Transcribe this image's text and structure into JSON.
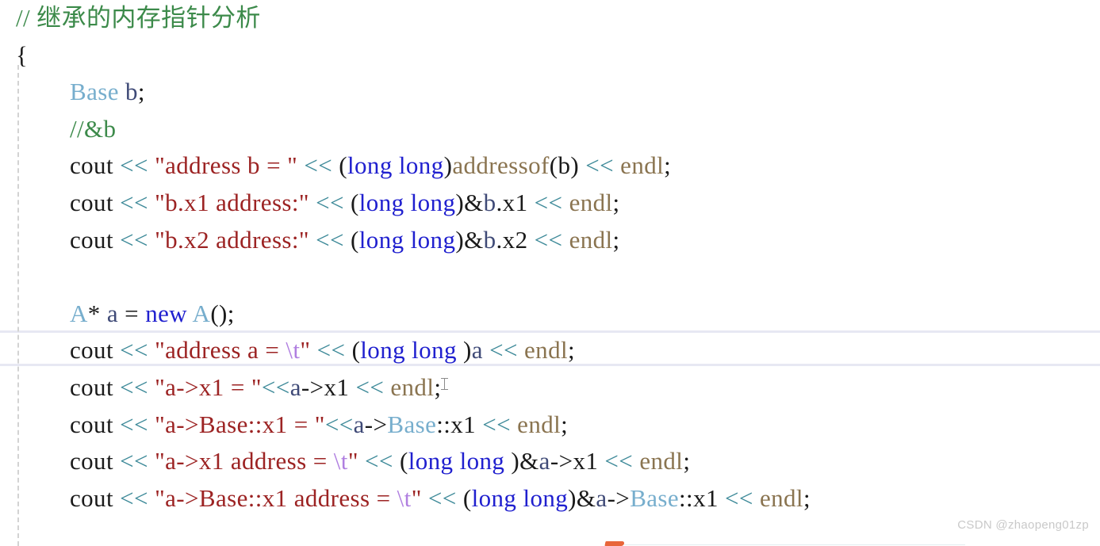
{
  "editor": {
    "language": "cpp",
    "background_color": "#ffffff",
    "current_line_number": 9,
    "indent_guide_color": "#d3d3d3",
    "current_line_highlight_color": "#e7e8f3"
  },
  "palette": {
    "comment": "#3c8a4a",
    "string": "#9c2323",
    "escape": "#b07fe0",
    "keyword": "#2020cf",
    "type": "#77aecd",
    "variable": "#3f4a77",
    "operator": "#3e8a99",
    "function": "#8a7450",
    "plain": "#1a1a1a"
  },
  "lines": [
    {
      "id": 1,
      "indent": 0,
      "tokens": [
        {
          "t": "comment",
          "v": "// 继承的内存指针分析"
        }
      ]
    },
    {
      "id": 2,
      "indent": 0,
      "tokens": [
        {
          "t": "punct",
          "v": "{"
        }
      ]
    },
    {
      "id": 3,
      "indent": 1,
      "tokens": [
        {
          "t": "type",
          "v": "Base"
        },
        {
          "t": "plain",
          "v": " "
        },
        {
          "t": "var",
          "v": "b"
        },
        {
          "t": "punct",
          "v": ";"
        }
      ]
    },
    {
      "id": 4,
      "indent": 1,
      "tokens": [
        {
          "t": "comment",
          "v": "//&b"
        }
      ]
    },
    {
      "id": 5,
      "indent": 1,
      "tokens": [
        {
          "t": "plain",
          "v": "cout "
        },
        {
          "t": "operator",
          "v": "<<"
        },
        {
          "t": "plain",
          "v": " "
        },
        {
          "t": "string",
          "v": "\"address b = \""
        },
        {
          "t": "plain",
          "v": " "
        },
        {
          "t": "operator",
          "v": "<<"
        },
        {
          "t": "plain",
          "v": " ("
        },
        {
          "t": "keyword",
          "v": "long long"
        },
        {
          "t": "plain",
          "v": ")"
        },
        {
          "t": "func",
          "v": "addressof"
        },
        {
          "t": "plain",
          "v": "(b) "
        },
        {
          "t": "operator",
          "v": "<<"
        },
        {
          "t": "plain",
          "v": " "
        },
        {
          "t": "stream",
          "v": "endl"
        },
        {
          "t": "punct",
          "v": ";"
        }
      ]
    },
    {
      "id": 6,
      "indent": 1,
      "tokens": [
        {
          "t": "plain",
          "v": "cout "
        },
        {
          "t": "operator",
          "v": "<<"
        },
        {
          "t": "plain",
          "v": " "
        },
        {
          "t": "string",
          "v": "\"b.x1 address:\""
        },
        {
          "t": "plain",
          "v": " "
        },
        {
          "t": "operator",
          "v": "<<"
        },
        {
          "t": "plain",
          "v": " ("
        },
        {
          "t": "keyword",
          "v": "long long"
        },
        {
          "t": "plain",
          "v": ")&"
        },
        {
          "t": "var",
          "v": "b"
        },
        {
          "t": "plain",
          "v": ".x1 "
        },
        {
          "t": "operator",
          "v": "<<"
        },
        {
          "t": "plain",
          "v": " "
        },
        {
          "t": "stream",
          "v": "endl"
        },
        {
          "t": "punct",
          "v": ";"
        }
      ]
    },
    {
      "id": 7,
      "indent": 1,
      "tokens": [
        {
          "t": "plain",
          "v": "cout "
        },
        {
          "t": "operator",
          "v": "<<"
        },
        {
          "t": "plain",
          "v": " "
        },
        {
          "t": "string",
          "v": "\"b.x2 address:\""
        },
        {
          "t": "plain",
          "v": " "
        },
        {
          "t": "operator",
          "v": "<<"
        },
        {
          "t": "plain",
          "v": " ("
        },
        {
          "t": "keyword",
          "v": "long long"
        },
        {
          "t": "plain",
          "v": ")&"
        },
        {
          "t": "var",
          "v": "b"
        },
        {
          "t": "plain",
          "v": ".x2 "
        },
        {
          "t": "operator",
          "v": "<<"
        },
        {
          "t": "plain",
          "v": " "
        },
        {
          "t": "stream",
          "v": "endl"
        },
        {
          "t": "punct",
          "v": ";"
        }
      ]
    },
    {
      "id": 8,
      "indent": 1,
      "tokens": []
    },
    {
      "id": 9,
      "indent": 1,
      "tokens": [
        {
          "t": "type",
          "v": "A"
        },
        {
          "t": "plain",
          "v": "* "
        },
        {
          "t": "var",
          "v": "a"
        },
        {
          "t": "plain",
          "v": " = "
        },
        {
          "t": "keyword",
          "v": "new"
        },
        {
          "t": "plain",
          "v": " "
        },
        {
          "t": "type",
          "v": "A"
        },
        {
          "t": "plain",
          "v": "()"
        },
        {
          "t": "punct",
          "v": ";"
        }
      ]
    },
    {
      "id": 10,
      "indent": 1,
      "highlighted": true,
      "tokens": [
        {
          "t": "plain",
          "v": "cout "
        },
        {
          "t": "operator",
          "v": "<<"
        },
        {
          "t": "plain",
          "v": " "
        },
        {
          "t": "string",
          "v": "\"address a = "
        },
        {
          "t": "escape",
          "v": "\\t"
        },
        {
          "t": "string",
          "v": "\""
        },
        {
          "t": "plain",
          "v": " "
        },
        {
          "t": "operator",
          "v": "<<"
        },
        {
          "t": "plain",
          "v": " ("
        },
        {
          "t": "keyword",
          "v": "long long"
        },
        {
          "t": "plain",
          "v": " )"
        },
        {
          "t": "var",
          "v": "a"
        },
        {
          "t": "plain",
          "v": " "
        },
        {
          "t": "operator",
          "v": "<<"
        },
        {
          "t": "plain",
          "v": " "
        },
        {
          "t": "stream",
          "v": "endl"
        },
        {
          "t": "punct",
          "v": ";"
        }
      ]
    },
    {
      "id": 11,
      "indent": 1,
      "caret_at_end": true,
      "tokens": [
        {
          "t": "plain",
          "v": "cout "
        },
        {
          "t": "operator",
          "v": "<<"
        },
        {
          "t": "plain",
          "v": " "
        },
        {
          "t": "string",
          "v": "\"a->x1 = \""
        },
        {
          "t": "operator",
          "v": "<<"
        },
        {
          "t": "var",
          "v": "a"
        },
        {
          "t": "plain",
          "v": "->x1 "
        },
        {
          "t": "operator",
          "v": "<<"
        },
        {
          "t": "plain",
          "v": " "
        },
        {
          "t": "stream",
          "v": "endl"
        },
        {
          "t": "punct",
          "v": ";"
        }
      ]
    },
    {
      "id": 12,
      "indent": 1,
      "tokens": [
        {
          "t": "plain",
          "v": "cout "
        },
        {
          "t": "operator",
          "v": "<<"
        },
        {
          "t": "plain",
          "v": " "
        },
        {
          "t": "string",
          "v": "\"a->Base::x1 = \""
        },
        {
          "t": "operator",
          "v": "<<"
        },
        {
          "t": "var",
          "v": "a"
        },
        {
          "t": "plain",
          "v": "->"
        },
        {
          "t": "type",
          "v": "Base"
        },
        {
          "t": "plain",
          "v": "::x1 "
        },
        {
          "t": "operator",
          "v": "<<"
        },
        {
          "t": "plain",
          "v": " "
        },
        {
          "t": "stream",
          "v": "endl"
        },
        {
          "t": "punct",
          "v": ";"
        }
      ]
    },
    {
      "id": 13,
      "indent": 1,
      "tokens": [
        {
          "t": "plain",
          "v": "cout "
        },
        {
          "t": "operator",
          "v": "<<"
        },
        {
          "t": "plain",
          "v": " "
        },
        {
          "t": "string",
          "v": "\"a->x1 address = "
        },
        {
          "t": "escape",
          "v": "\\t"
        },
        {
          "t": "string",
          "v": "\""
        },
        {
          "t": "plain",
          "v": " "
        },
        {
          "t": "operator",
          "v": "<<"
        },
        {
          "t": "plain",
          "v": " ("
        },
        {
          "t": "keyword",
          "v": "long long"
        },
        {
          "t": "plain",
          "v": " )&"
        },
        {
          "t": "var",
          "v": "a"
        },
        {
          "t": "plain",
          "v": "->x1 "
        },
        {
          "t": "operator",
          "v": "<<"
        },
        {
          "t": "plain",
          "v": " "
        },
        {
          "t": "stream",
          "v": "endl"
        },
        {
          "t": "punct",
          "v": ";"
        }
      ]
    },
    {
      "id": 14,
      "indent": 1,
      "tokens": [
        {
          "t": "plain",
          "v": "cout "
        },
        {
          "t": "operator",
          "v": "<<"
        },
        {
          "t": "plain",
          "v": " "
        },
        {
          "t": "string",
          "v": "\"a->Base::x1 address = "
        },
        {
          "t": "escape",
          "v": "\\t"
        },
        {
          "t": "string",
          "v": "\""
        },
        {
          "t": "plain",
          "v": " "
        },
        {
          "t": "operator",
          "v": "<<"
        },
        {
          "t": "plain",
          "v": " ("
        },
        {
          "t": "keyword",
          "v": "long long"
        },
        {
          "t": "plain",
          "v": ")&"
        },
        {
          "t": "var",
          "v": "a"
        },
        {
          "t": "plain",
          "v": "->"
        },
        {
          "t": "type",
          "v": "Base"
        },
        {
          "t": "plain",
          "v": "::x1 "
        },
        {
          "t": "operator",
          "v": "<<"
        },
        {
          "t": "plain",
          "v": " "
        },
        {
          "t": "stream",
          "v": "endl"
        },
        {
          "t": "punct",
          "v": ";"
        }
      ]
    }
  ],
  "watermark": {
    "text": "CSDN @zhaopeng01zp"
  }
}
